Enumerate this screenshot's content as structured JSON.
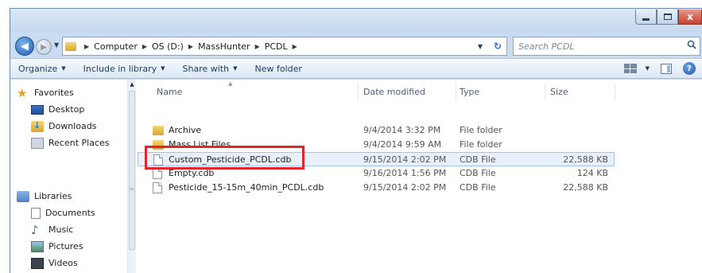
{
  "window": {
    "minimize_glyph": "",
    "close_glyph": "x"
  },
  "address": {
    "crumbs": [
      "Computer",
      "OS (D:)",
      "MassHunter",
      "PCDL"
    ],
    "search_placeholder": "Search PCDL"
  },
  "toolbar": {
    "organize": "Organize",
    "include_in_library": "Include in library",
    "share_with": "Share with",
    "new_folder": "New folder",
    "help": "?"
  },
  "nav": {
    "favorites_label": "Favorites",
    "favorites": [
      "Desktop",
      "Downloads",
      "Recent Places"
    ],
    "libraries_label": "Libraries",
    "libraries": [
      "Documents",
      "Music",
      "Pictures",
      "Videos"
    ]
  },
  "columns": {
    "name": "Name",
    "date": "Date modified",
    "type": "Type",
    "size": "Size"
  },
  "files": [
    {
      "name": "Archive",
      "date": "9/4/2014 3:32 PM",
      "type": "File folder",
      "size": "",
      "kind": "folder"
    },
    {
      "name": "Mass List Files",
      "date": "9/4/2014 9:59 AM",
      "type": "File folder",
      "size": "",
      "kind": "folder"
    },
    {
      "name": "Custom_Pesticide_PCDL.cdb",
      "date": "9/15/2014 2:02 PM",
      "type": "CDB File",
      "size": "22,588 KB",
      "kind": "file",
      "selected": true
    },
    {
      "name": "Empty.cdb",
      "date": "9/16/2014 1:56 PM",
      "type": "CDB File",
      "size": "124 KB",
      "kind": "file"
    },
    {
      "name": "Pesticide_15-15m_40min_PCDL.cdb",
      "date": "9/15/2014 2:02 PM",
      "type": "CDB File",
      "size": "22,588 KB",
      "kind": "file"
    }
  ],
  "colors": {
    "highlight_box": "#e5242a",
    "selection_fill": "#e8f1fb",
    "window_frame": "#c9dcf0"
  }
}
